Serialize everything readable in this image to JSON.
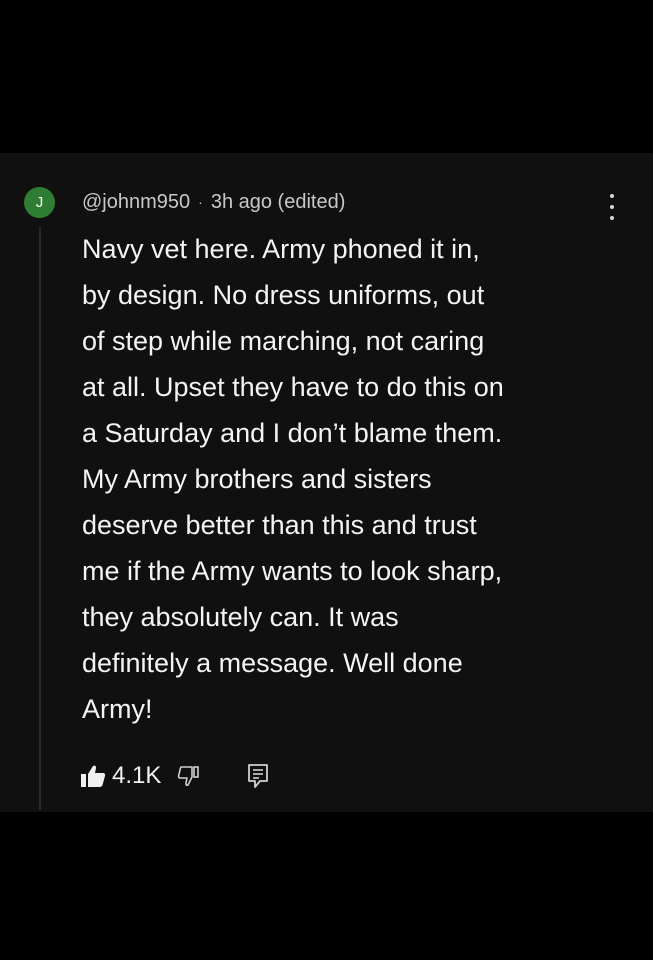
{
  "comment": {
    "avatar_letter": "J",
    "avatar_color": "#2f7d32",
    "author": "@johnm950",
    "separator": "·",
    "timestamp": "3h ago (edited)",
    "menu_icon": "more-vertical-icon",
    "body_lines": [
      "Navy vet here. Army phoned it in,",
      "by design. No dress uniforms, out",
      "of step while marching, not caring",
      "at all. Upset they have to do this on",
      "a Saturday and I don’t blame them.",
      "My Army brothers and sisters",
      "deserve better than this and trust",
      "me if the Army wants to look sharp,",
      "they absolutely can. It was",
      "definitely a message. Well done",
      "Army!"
    ],
    "actions": {
      "like_icon": "thumbs-up-filled-icon",
      "like_count": "4.1K",
      "dislike_icon": "thumbs-down-outline-icon",
      "reply_icon": "reply-comment-icon"
    }
  }
}
